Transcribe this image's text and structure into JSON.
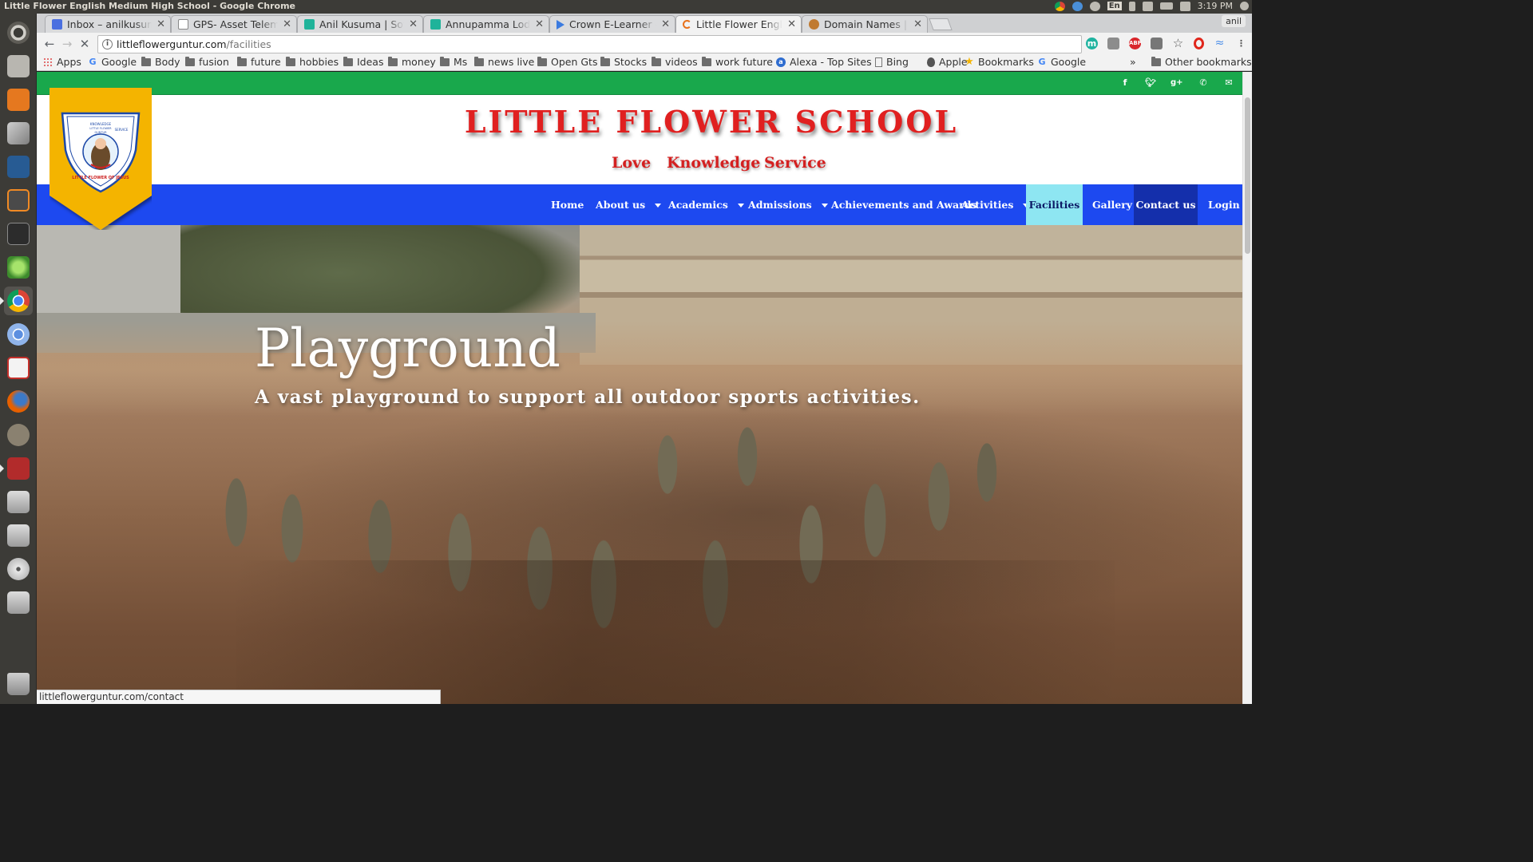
{
  "window": {
    "title": "Little Flower English Medium High School - Google Chrome"
  },
  "system": {
    "clock": "3:19 PM",
    "keyboard": "En",
    "user": "anil"
  },
  "tabs": [
    {
      "label": "Inbox – anilkusuma",
      "icon": "gmail-icon",
      "color": "#4a6fe0"
    },
    {
      "label": "GPS- Asset Telemat",
      "icon": "page-icon",
      "color": "#9e9e9e"
    },
    {
      "label": "Anil Kusuma | Softw",
      "icon": "leaf-icon",
      "color": "#1fb39a"
    },
    {
      "label": "Annupamma Lodge",
      "icon": "leaf-icon",
      "color": "#1fb39a"
    },
    {
      "label": "Crown E-Learner - A",
      "icon": "play-icon",
      "color": "#3b7be0"
    },
    {
      "label": "Little Flower Englis",
      "icon": "loading-icon",
      "color": "#e8711a"
    },
    {
      "label": "Domain Names | Th",
      "icon": "globe-icon",
      "color": "#c07a30"
    }
  ],
  "omnibox": {
    "host": "littleflowerguntur.com",
    "path": "/facilities"
  },
  "bookmarks": [
    {
      "label": "Apps",
      "icon": "apps"
    },
    {
      "label": "Google",
      "icon": "google"
    },
    {
      "label": "Body",
      "icon": "folder"
    },
    {
      "label": "fusion",
      "icon": "folder"
    },
    {
      "label": "future",
      "icon": "folder"
    },
    {
      "label": "hobbies",
      "icon": "folder"
    },
    {
      "label": "Ideas",
      "icon": "folder"
    },
    {
      "label": "money",
      "icon": "folder"
    },
    {
      "label": "Ms",
      "icon": "folder"
    },
    {
      "label": "news live",
      "icon": "folder"
    },
    {
      "label": "Open Gts",
      "icon": "folder"
    },
    {
      "label": "Stocks",
      "icon": "folder"
    },
    {
      "label": "videos",
      "icon": "folder"
    },
    {
      "label": "work future",
      "icon": "folder"
    },
    {
      "label": "Alexa - Top Sites",
      "icon": "alexa"
    },
    {
      "label": "Bing",
      "icon": "page"
    },
    {
      "label": "Apple",
      "icon": "apple"
    },
    {
      "label": "Bookmarks",
      "icon": "star"
    },
    {
      "label": "Google",
      "icon": "google"
    }
  ],
  "bookmarks_overflow": "»",
  "other_bookmarks": "Other bookmarks",
  "site": {
    "title": "LITTLE FLOWER SCHOOL",
    "motto": [
      "Love",
      "Knowledge",
      "Service"
    ],
    "crest_text": [
      "KNOWLEDGE",
      "SERVICE",
      "LITTLE FLOWER",
      "GUNTUR",
      "LITTLE FLOWER OF JESUS"
    ],
    "nav": [
      {
        "label": "Home",
        "dropdown": false
      },
      {
        "label": "About us",
        "dropdown": true
      },
      {
        "label": "Academics",
        "dropdown": true
      },
      {
        "label": "Admissions",
        "dropdown": true
      },
      {
        "label": "Achievements and Awards",
        "dropdown": false
      },
      {
        "label": "Activities",
        "dropdown": true
      },
      {
        "label": "Facilities",
        "dropdown": false,
        "current": true
      },
      {
        "label": "Gallery",
        "dropdown": false
      },
      {
        "label": "Contact us",
        "dropdown": false
      },
      {
        "label": "Login",
        "dropdown": false
      }
    ],
    "hero": {
      "title": "Playground",
      "subtitle": "A vast playground to support all outdoor sports activities."
    },
    "colors": {
      "social_bar": "#19a84c",
      "nav": "#1d49f0",
      "title_red": "#e02020",
      "crest_gold": "#f4b400",
      "current_tab": "#8ee6f2"
    }
  },
  "status_bar": "littleflowerguntur.com/contact"
}
